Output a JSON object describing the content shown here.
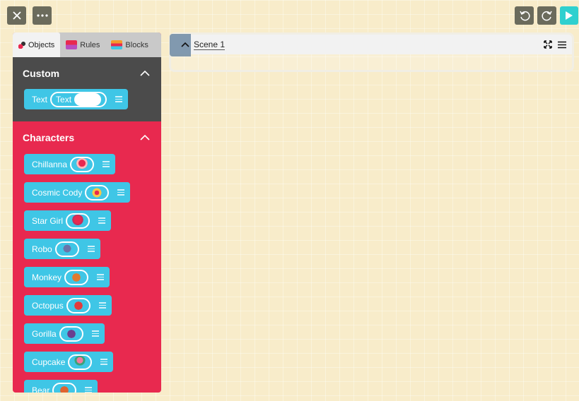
{
  "toolbar": {
    "close_icon": "close-icon",
    "more_icon": "more-icon",
    "undo_icon": "undo-icon",
    "redo_icon": "redo-icon",
    "play_icon": "play-icon",
    "play_color": "#2fd0cf"
  },
  "tabs": [
    {
      "label": "Objects",
      "active": true
    },
    {
      "label": "Rules",
      "active": false
    },
    {
      "label": "Blocks",
      "active": false
    }
  ],
  "custom": {
    "title": "Custom",
    "items": [
      {
        "label": "Text",
        "value": "Text"
      }
    ]
  },
  "characters": {
    "title": "Characters",
    "items": [
      {
        "label": "Chillanna"
      },
      {
        "label": "Cosmic Cody"
      },
      {
        "label": "Star Girl"
      },
      {
        "label": "Robo"
      },
      {
        "label": "Monkey"
      },
      {
        "label": "Octopus"
      },
      {
        "label": "Gorilla"
      },
      {
        "label": "Cupcake"
      },
      {
        "label": "Bear"
      }
    ]
  },
  "scene": {
    "title": "Scene 1"
  },
  "colors": {
    "background": "#f8ecca",
    "custom_section": "#4b4b4b",
    "characters_section": "#e8294f",
    "pill": "#3fc6e6"
  }
}
